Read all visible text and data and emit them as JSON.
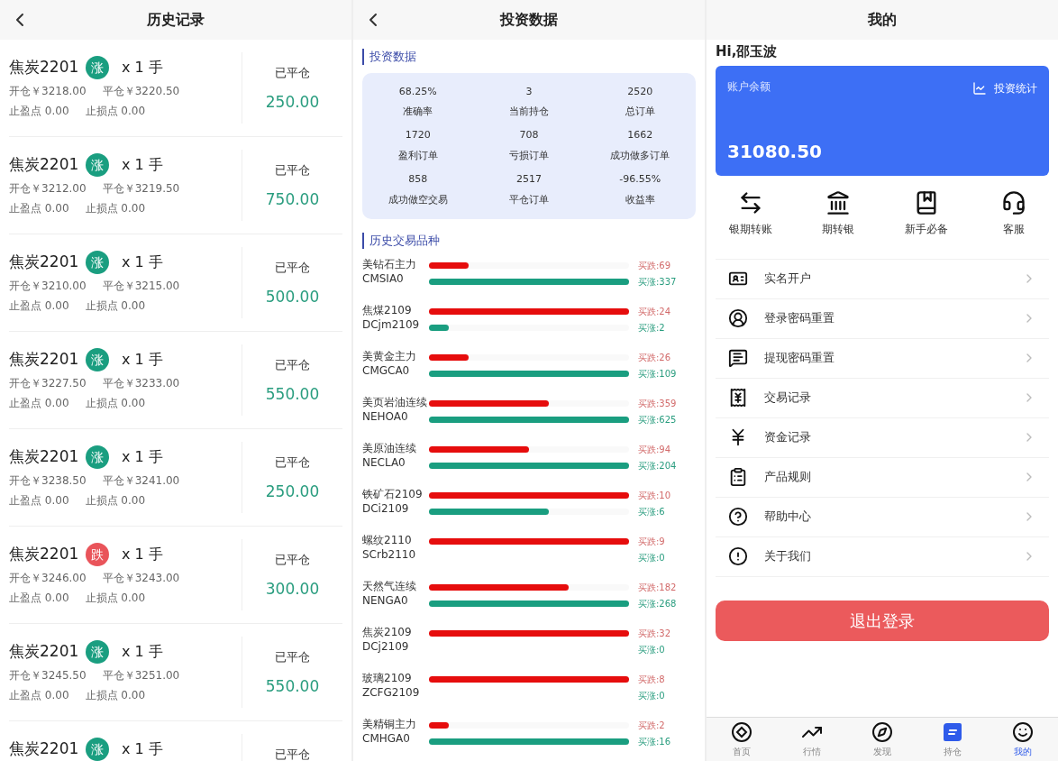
{
  "history": {
    "title": "历史记录",
    "rows": [
      {
        "name": "焦炭2201",
        "badge": {
          "text": "涨",
          "color": "#1a9e80"
        },
        "qty": "x 1 手",
        "open": "开仓￥3218.00",
        "close": "平仓￥3220.50",
        "take_profit": "止盈点 0.00",
        "stop_loss": "止损点 0.00",
        "status": "已平仓",
        "amount": "250.00"
      },
      {
        "name": "焦炭2201",
        "badge": {
          "text": "涨",
          "color": "#1a9e80"
        },
        "qty": "x 1 手",
        "open": "开仓￥3212.00",
        "close": "平仓￥3219.50",
        "take_profit": "止盈点 0.00",
        "stop_loss": "止损点 0.00",
        "status": "已平仓",
        "amount": "750.00"
      },
      {
        "name": "焦炭2201",
        "badge": {
          "text": "涨",
          "color": "#1a9e80"
        },
        "qty": "x 1 手",
        "open": "开仓￥3210.00",
        "close": "平仓￥3215.00",
        "take_profit": "止盈点 0.00",
        "stop_loss": "止损点 0.00",
        "status": "已平仓",
        "amount": "500.00"
      },
      {
        "name": "焦炭2201",
        "badge": {
          "text": "涨",
          "color": "#1a9e80"
        },
        "qty": "x 1 手",
        "open": "开仓￥3227.50",
        "close": "平仓￥3233.00",
        "take_profit": "止盈点 0.00",
        "stop_loss": "止损点 0.00",
        "status": "已平仓",
        "amount": "550.00"
      },
      {
        "name": "焦炭2201",
        "badge": {
          "text": "涨",
          "color": "#1a9e80"
        },
        "qty": "x 1 手",
        "open": "开仓￥3238.50",
        "close": "平仓￥3241.00",
        "take_profit": "止盈点 0.00",
        "stop_loss": "止损点 0.00",
        "status": "已平仓",
        "amount": "250.00"
      },
      {
        "name": "焦炭2201",
        "badge": {
          "text": "跌",
          "color": "#e9545a"
        },
        "qty": "x 1 手",
        "open": "开仓￥3246.00",
        "close": "平仓￥3243.00",
        "take_profit": "止盈点 0.00",
        "stop_loss": "止损点 0.00",
        "status": "已平仓",
        "amount": "300.00"
      },
      {
        "name": "焦炭2201",
        "badge": {
          "text": "涨",
          "color": "#1a9e80"
        },
        "qty": "x 1 手",
        "open": "开仓￥3245.50",
        "close": "平仓￥3251.00",
        "take_profit": "止盈点 0.00",
        "stop_loss": "止损点 0.00",
        "status": "已平仓",
        "amount": "550.00"
      },
      {
        "name": "焦炭2201",
        "badge": {
          "text": "涨",
          "color": "#1a9e80"
        },
        "qty": "x 1 手",
        "status": "已平仓"
      }
    ]
  },
  "investment": {
    "title": "投资数据",
    "stats_heading": "投资数据",
    "stats": [
      {
        "value": "68.25%",
        "label": "准确率"
      },
      {
        "value": "3",
        "label": "当前持仓"
      },
      {
        "value": "2520",
        "label": "总订单"
      },
      {
        "value": "1720",
        "label": "盈利订单"
      },
      {
        "value": "708",
        "label": "亏损订单"
      },
      {
        "value": "1662",
        "label": "成功做多订单"
      },
      {
        "value": "858",
        "label": "成功做空交易"
      },
      {
        "value": "2517",
        "label": "平仓订单"
      },
      {
        "value": "-96.55%",
        "label": "收益率"
      }
    ],
    "products_heading": "历史交易品种",
    "products": [
      {
        "name": "美钻石主力",
        "code": "CMSIA0",
        "down": {
          "label": "买跌:69",
          "level": 0.2
        },
        "up": {
          "label": "买涨:337",
          "level": 1
        }
      },
      {
        "name": "焦煤2109",
        "code": "DCjm2109",
        "down": {
          "label": "买跌:24",
          "level": 1
        },
        "up": {
          "label": "买涨:2",
          "level": 0.1
        }
      },
      {
        "name": "美黄金主力",
        "code": "CMGCA0",
        "down": {
          "label": "买跌:26",
          "level": 0.2
        },
        "up": {
          "label": "买涨:109",
          "level": 1
        }
      },
      {
        "name": "美页岩油连续",
        "code": "NEHOA0",
        "down": {
          "label": "买跌:359",
          "level": 0.6
        },
        "up": {
          "label": "买涨:625",
          "level": 1
        }
      },
      {
        "name": "美原油连续",
        "code": "NECLA0",
        "down": {
          "label": "买跌:94",
          "level": 0.5
        },
        "up": {
          "label": "买涨:204",
          "level": 1
        }
      },
      {
        "name": "铁矿石2109",
        "code": "DCi2109",
        "down": {
          "label": "买跌:10",
          "level": 1
        },
        "up": {
          "label": "买涨:6",
          "level": 0.6
        }
      },
      {
        "name": "螺纹2110",
        "code": "SCrb2110",
        "down": {
          "label": "买跌:9",
          "level": 1
        },
        "up": {
          "label": "买涨:0"
        }
      },
      {
        "name": "天然气连续",
        "code": "NENGA0",
        "down": {
          "label": "买跌:182",
          "level": 0.7
        },
        "up": {
          "label": "买涨:268",
          "level": 1
        }
      },
      {
        "name": "焦炭2109",
        "code": "DCj2109",
        "down": {
          "label": "买跌:32",
          "level": 1
        },
        "up": {
          "label": "买涨:0"
        }
      },
      {
        "name": "玻璃2109",
        "code": "ZCFG2109",
        "down": {
          "label": "买跌:8",
          "level": 1
        },
        "up": {
          "label": "买涨:0"
        }
      },
      {
        "name": "美精铜主力",
        "code": "CMHGA0",
        "down": {
          "label": "买跌:2",
          "level": 0.1
        },
        "up": {
          "label": "买涨:16",
          "level": 1
        }
      }
    ]
  },
  "profile": {
    "title": "我的",
    "greeting": "Hi,邵玉波",
    "balance_label": "账户余额",
    "stats_link": "投资统计",
    "balance": "31080.50",
    "shortcuts": [
      "银期转账",
      "期转银",
      "新手必备",
      "客服"
    ],
    "menu": [
      "实名开户",
      "登录密码重置",
      "提现密码重置",
      "交易记录",
      "资金记录",
      "产品规则",
      "帮助中心",
      "关于我们"
    ],
    "logout": "退出登录",
    "nav": [
      {
        "label": "首页",
        "selected": false
      },
      {
        "label": "行情",
        "selected": false
      },
      {
        "label": "发现",
        "selected": false
      },
      {
        "label": "持仓",
        "selected": false
      },
      {
        "label": "我的",
        "selected": true
      }
    ]
  }
}
